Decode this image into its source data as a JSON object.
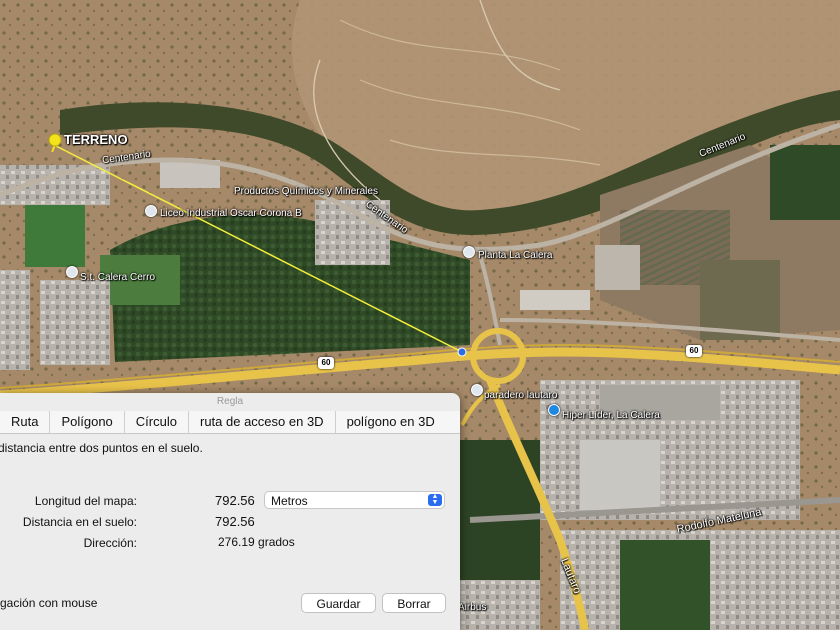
{
  "map": {
    "labels": {
      "terreno": "TERRENO",
      "centenario_1": "Centenario",
      "centenario_2": "Centenario",
      "centenario_3": "Centenario",
      "productos": "Productos Químicos y Minerales",
      "liceo": "Liceo Industrial Oscar Corona B",
      "calera_cerro": "S.t. Calera Cerro",
      "planta": "Planta La Calera",
      "paradero": "paradero lautaro",
      "hiper": "Hiper Líder, La Calera",
      "rodolfo": "Rodolfo Mateluna",
      "lautaro": "Lautaro",
      "airbus": "Airbus",
      "route_60_a": "60",
      "route_60_b": "60"
    }
  },
  "ruler": {
    "title": "Regla",
    "tabs": [
      "Ruta",
      "Polígono",
      "Círculo",
      "ruta de acceso en 3D",
      "polígono en 3D"
    ],
    "description": "distancia entre dos puntos en el suelo.",
    "map_length_label": "Longitud del mapa:",
    "map_length_value": "792.56",
    "unit_selected": "Metros",
    "ground_distance_label": "Distancia en el suelo:",
    "ground_distance_value": "792.56",
    "direction_label": "Dirección:",
    "direction_value": "276.19 grados",
    "mouse_nav_label": "gación con mouse",
    "save_button": "Guardar",
    "clear_button": "Borrar"
  },
  "colors": {
    "measure_line": "#f5ee3a",
    "highway": "#e8c34a",
    "pin": "#f4e21a"
  }
}
